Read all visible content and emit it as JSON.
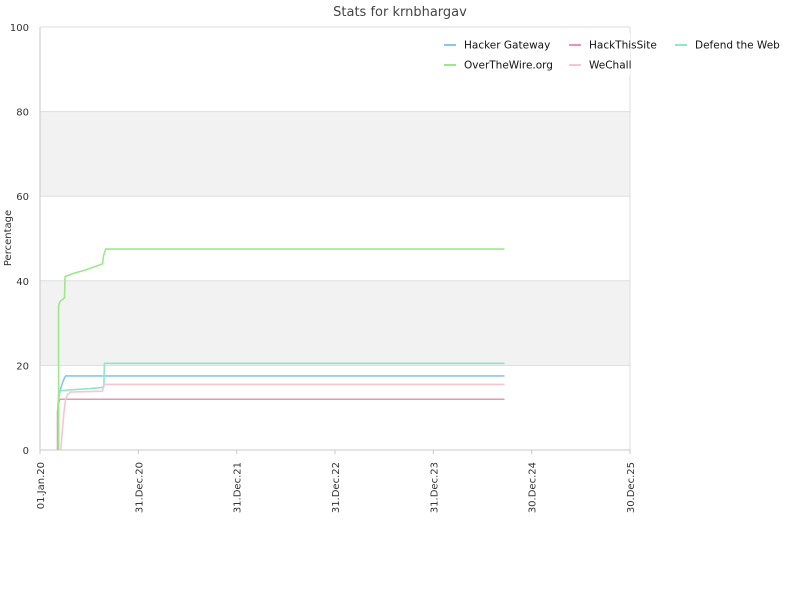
{
  "chart_data": {
    "type": "line",
    "title": "Stats for krnbhargav",
    "xlabel": "",
    "ylabel": "Percentage",
    "ylim": [
      0,
      100
    ],
    "xlim": [
      "2020-01-01",
      "2025-12-30"
    ],
    "yticks": [
      0,
      20,
      40,
      60,
      80,
      100
    ],
    "xticks": [
      {
        "date": "2020-01-01",
        "label": "01.Jan.20"
      },
      {
        "date": "2020-12-31",
        "label": "31.Dec.20"
      },
      {
        "date": "2021-12-31",
        "label": "31.Dec.21"
      },
      {
        "date": "2022-12-31",
        "label": "31.Dec.22"
      },
      {
        "date": "2023-12-31",
        "label": "31.Dec.23"
      },
      {
        "date": "2024-12-30",
        "label": "30.Dec.24"
      },
      {
        "date": "2025-12-30",
        "label": "30.Dec.25"
      }
    ],
    "grid": true,
    "alternating_bands": true,
    "legend_position": "top-right",
    "series": [
      {
        "name": "Hacker Gateway",
        "color": "#8ec3ee",
        "points": [
          [
            "2020-03-08",
            0
          ],
          [
            "2020-03-08",
            11
          ],
          [
            "2020-03-12",
            13
          ],
          [
            "2020-03-20",
            15
          ],
          [
            "2020-03-28",
            16.5
          ],
          [
            "2020-04-05",
            17.5
          ],
          [
            "2024-09-20",
            17.5
          ]
        ]
      },
      {
        "name": "HackThisSite",
        "color": "#e995b0",
        "points": [
          [
            "2020-03-06",
            0
          ],
          [
            "2020-03-06",
            9
          ],
          [
            "2020-03-10",
            11
          ],
          [
            "2020-03-14",
            12
          ],
          [
            "2024-09-20",
            12
          ]
        ]
      },
      {
        "name": "Defend the Web",
        "color": "#8ee8c6",
        "points": [
          [
            "2020-03-10",
            0
          ],
          [
            "2020-03-10",
            13
          ],
          [
            "2020-03-16",
            14
          ],
          [
            "2020-04-20",
            14.2
          ],
          [
            "2020-07-01",
            14.5
          ],
          [
            "2020-08-20",
            14.8
          ],
          [
            "2020-08-25",
            15.2
          ],
          [
            "2020-08-27",
            20.5
          ],
          [
            "2024-09-20",
            20.5
          ]
        ]
      },
      {
        "name": "OverTheWire.org",
        "color": "#9ee68e",
        "points": [
          [
            "2020-03-10",
            0
          ],
          [
            "2020-03-10",
            34
          ],
          [
            "2020-03-14",
            35
          ],
          [
            "2020-04-01",
            36
          ],
          [
            "2020-04-03",
            41
          ],
          [
            "2020-05-01",
            41.7
          ],
          [
            "2020-06-15",
            42.5
          ],
          [
            "2020-08-20",
            44
          ],
          [
            "2020-08-24",
            46
          ],
          [
            "2020-09-01",
            47.5
          ],
          [
            "2024-09-20",
            47.5
          ]
        ]
      },
      {
        "name": "WeChall",
        "color": "#f5c6cf",
        "points": [
          [
            "2020-03-18",
            0
          ],
          [
            "2020-03-22",
            3
          ],
          [
            "2020-03-26",
            6
          ],
          [
            "2020-03-30",
            9
          ],
          [
            "2020-04-05",
            12
          ],
          [
            "2020-04-12",
            13
          ],
          [
            "2020-04-22",
            13.7
          ],
          [
            "2020-08-20",
            13.9
          ],
          [
            "2020-08-27",
            15.5
          ],
          [
            "2024-09-20",
            15.5
          ]
        ]
      }
    ]
  }
}
